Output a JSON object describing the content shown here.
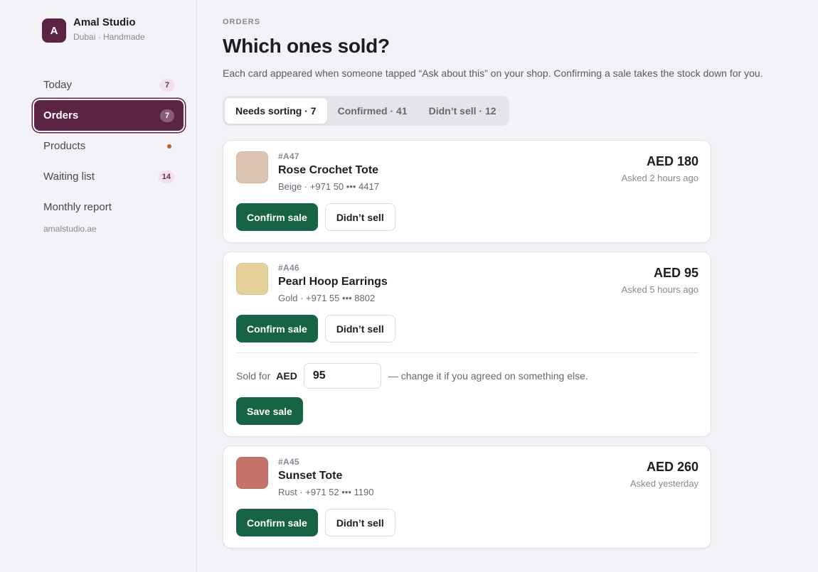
{
  "brand": {
    "initial": "A",
    "name": "Amal Studio",
    "subtitle": "Dubai · Handmade"
  },
  "nav": {
    "items": [
      {
        "label": "Today",
        "count": "7"
      },
      {
        "label": "Orders",
        "count": "7"
      },
      {
        "label": "Products"
      },
      {
        "label": "Waiting list",
        "count": "14"
      },
      {
        "label": "Monthly report"
      }
    ],
    "site": "amalstudio.ae"
  },
  "page": {
    "eyebrow": "ORDERS",
    "title": "Which ones sold?",
    "intro": "Each card appeared when someone tapped “Ask about this” on your shop. Confirming a sale takes the stock down for you."
  },
  "tabs": [
    {
      "label": "Needs sorting · 7"
    },
    {
      "label": "Confirmed · 41"
    },
    {
      "label": "Didn’t sell · 12"
    }
  ],
  "orders": [
    {
      "id": "#A47",
      "name": "Rose Crochet Tote",
      "meta": "Beige · +971 50 ••• 4417",
      "price": "AED 180",
      "asked": "Asked 2 hours ago",
      "swatch": "#dcc3b2"
    },
    {
      "id": "#A46",
      "name": "Pearl Hoop Earrings",
      "meta": "Gold · +971 55 ••• 8802",
      "price": "AED 95",
      "asked": "Asked 5 hours ago",
      "swatch": "#e6d19b"
    },
    {
      "id": "#A45",
      "name": "Sunset Tote",
      "meta": "Rust · +971 52 ••• 1190",
      "price": "AED 260",
      "asked": "Asked yesterday",
      "swatch": "#c5736a"
    }
  ],
  "actions": {
    "confirm": "Confirm sale",
    "didnt": "Didn’t sell",
    "save": "Save sale"
  },
  "sale_form": {
    "label": "Sold for",
    "currency": "AED",
    "value": "95",
    "hint": "— change it if you agreed on something else."
  },
  "colors": {
    "brand": "#5c2443",
    "primary_button": "#176445",
    "background": "#f3f2f6"
  }
}
